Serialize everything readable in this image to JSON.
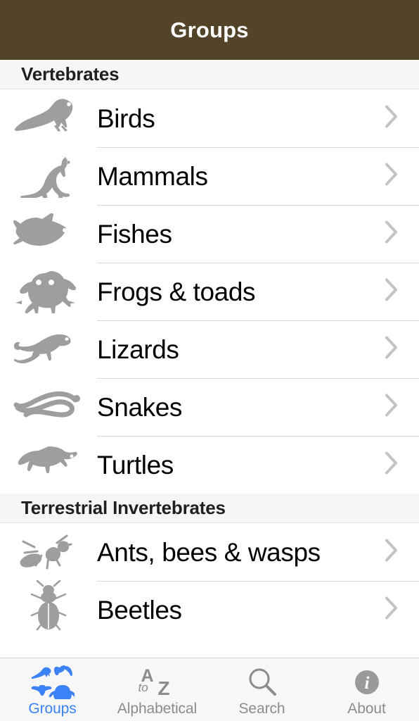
{
  "header": {
    "title": "Groups",
    "background_color": "#534429",
    "text_color": "#ffffff"
  },
  "colors": {
    "accent_blue": "#3b82f6",
    "icon_gray": "#9e9e9e",
    "chevron_gray": "#c4c4c4",
    "section_background": "#f6f6f6",
    "tabbar_background": "#f7f7f7",
    "inactive_tab": "#8c8c8c"
  },
  "list": {
    "sections": [
      {
        "title": "Vertebrates",
        "rows": [
          {
            "label": "Birds",
            "icon": "bird-icon",
            "chevron": "chevron-right-icon"
          },
          {
            "label": "Mammals",
            "icon": "kangaroo-icon",
            "chevron": "chevron-right-icon"
          },
          {
            "label": "Fishes",
            "icon": "fish-icon",
            "chevron": "chevron-right-icon"
          },
          {
            "label": "Frogs & toads",
            "icon": "frog-icon",
            "chevron": "chevron-right-icon"
          },
          {
            "label": "Lizards",
            "icon": "lizard-icon",
            "chevron": "chevron-right-icon"
          },
          {
            "label": "Snakes",
            "icon": "snake-icon",
            "chevron": "chevron-right-icon"
          },
          {
            "label": "Turtles",
            "icon": "turtle-icon",
            "chevron": "chevron-right-icon"
          }
        ]
      },
      {
        "title": "Terrestrial Invertebrates",
        "rows": [
          {
            "label": "Ants, bees & wasps",
            "icon": "ant-icon",
            "chevron": "chevron-right-icon"
          },
          {
            "label": "Beetles",
            "icon": "beetle-icon",
            "chevron": "chevron-right-icon"
          }
        ]
      }
    ]
  },
  "tabbar": {
    "tabs": [
      {
        "label": "Groups",
        "icon": "animal-grid-icon",
        "active": true
      },
      {
        "label": "Alphabetical",
        "icon": "a-to-z-icon",
        "active": false
      },
      {
        "label": "Search",
        "icon": "search-icon",
        "active": false
      },
      {
        "label": "About",
        "icon": "info-circle-icon",
        "active": false
      }
    ]
  }
}
